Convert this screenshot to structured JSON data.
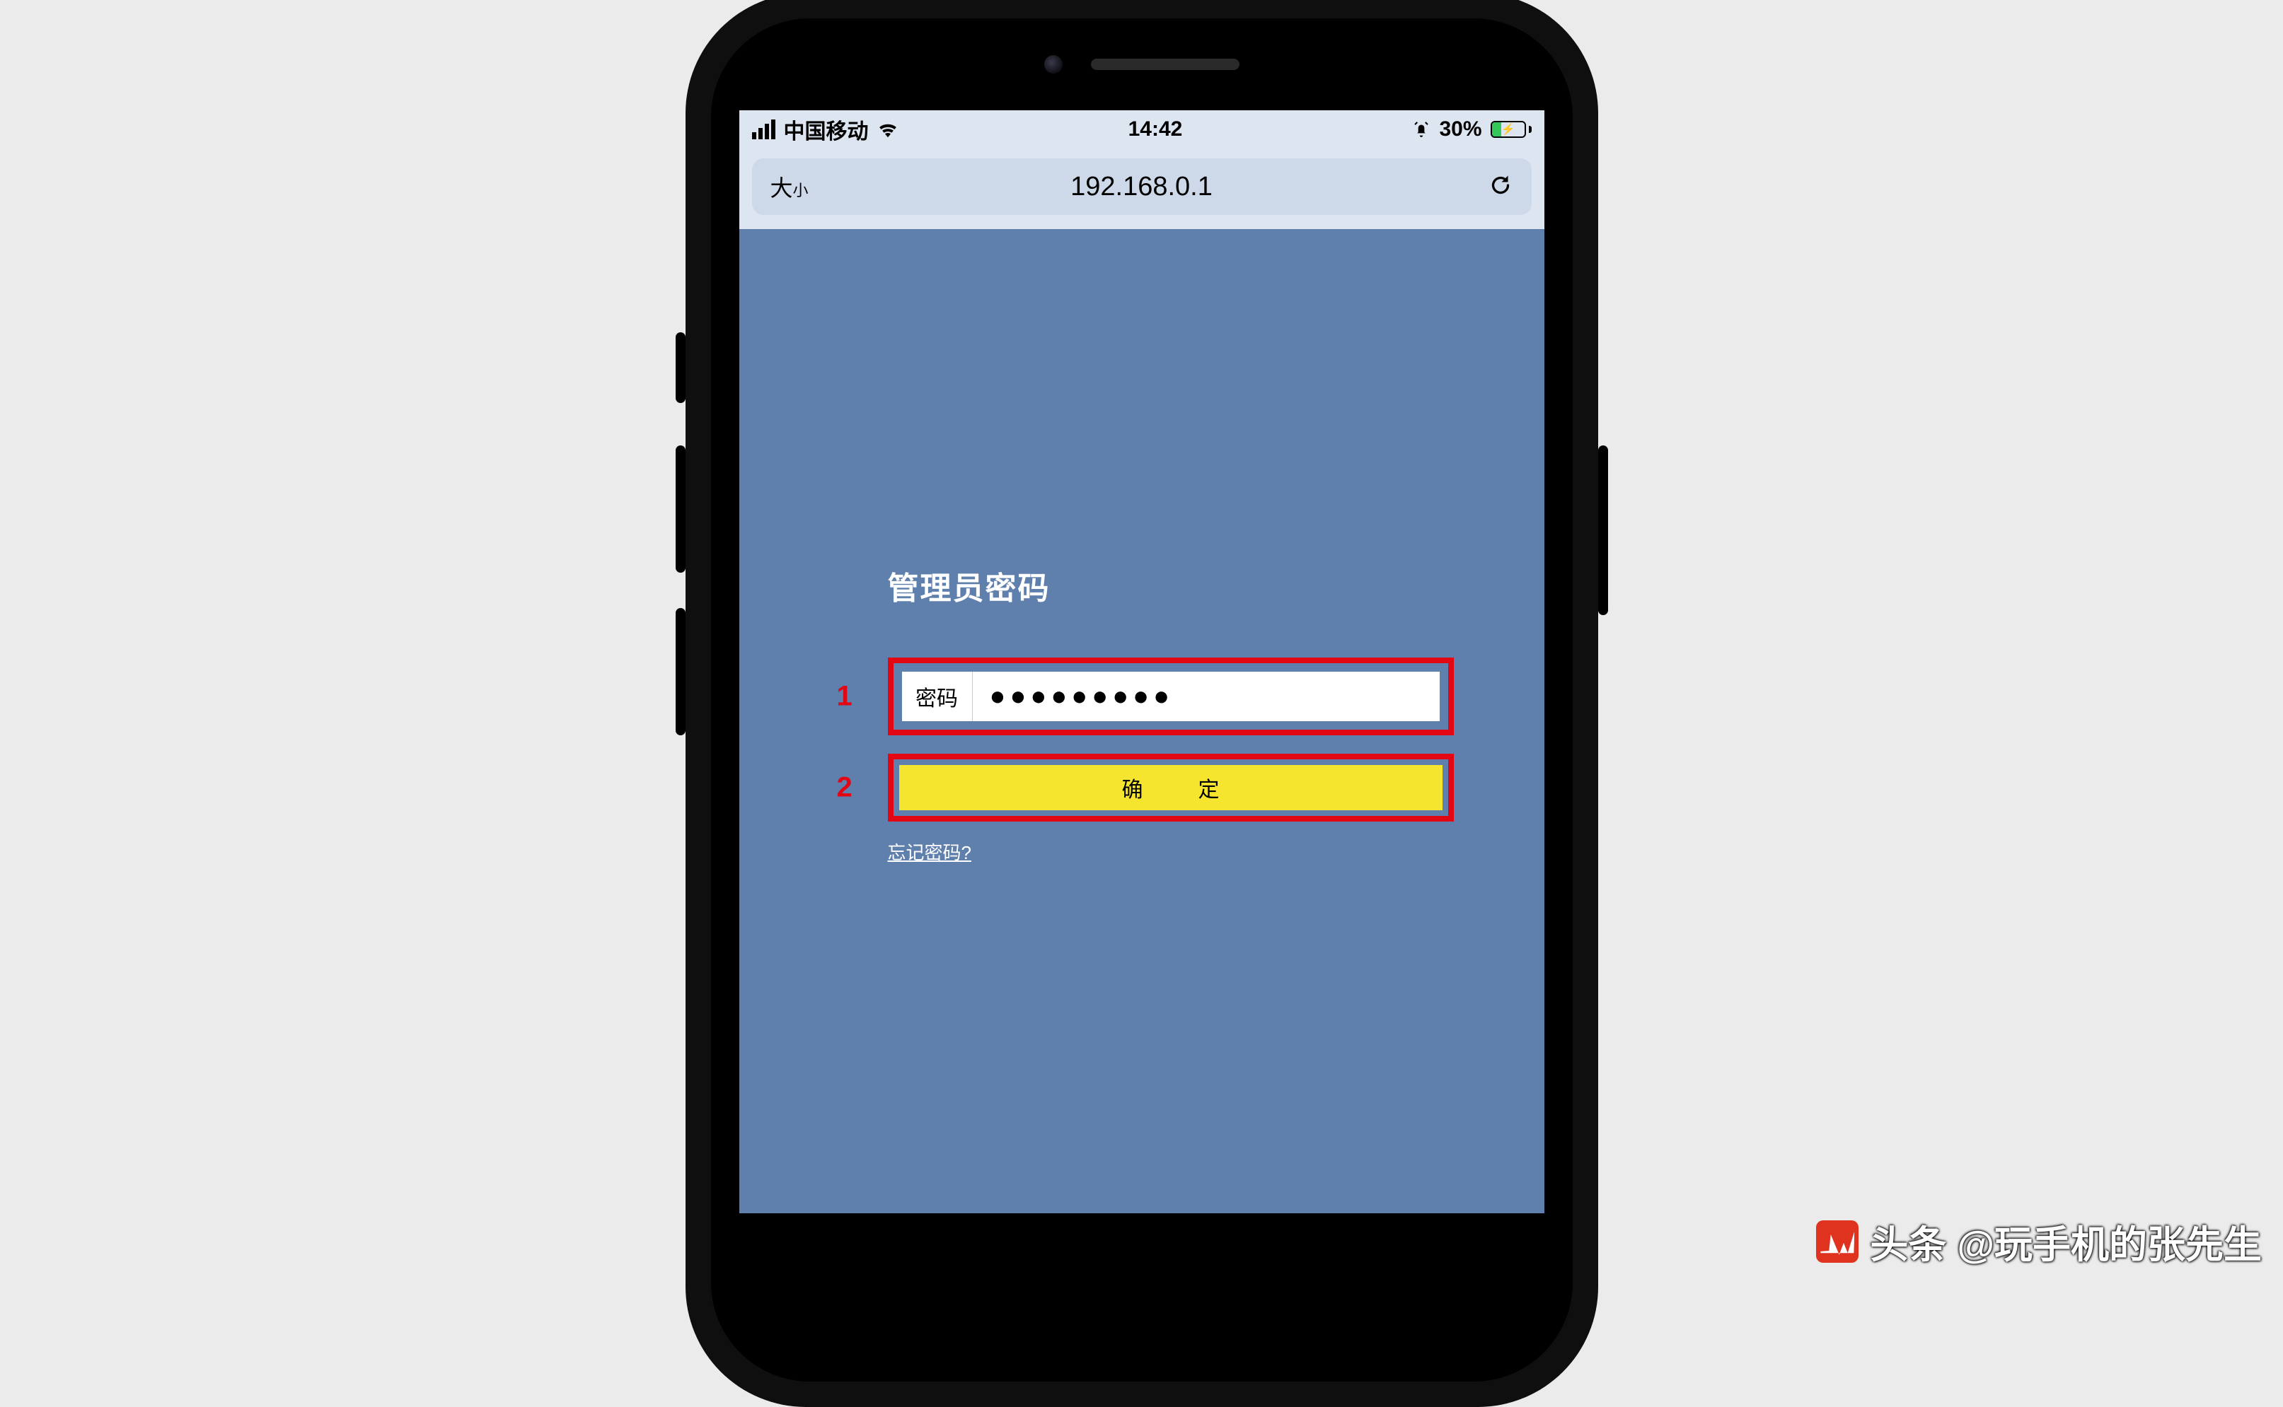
{
  "status": {
    "carrier": "中国移动",
    "time": "14:42",
    "battery_pct": "30%"
  },
  "browser": {
    "aa_large": "大",
    "aa_small": "小",
    "url": "192.168.0.1"
  },
  "login": {
    "title": "管理员密码",
    "password_label": "密码",
    "password_value": "●●●●●●●●●",
    "confirm_label": "确　定",
    "forgot_label": "忘记密码?"
  },
  "annotations": {
    "num1": "1",
    "num2": "2"
  },
  "watermark": {
    "text": "头条 @玩手机的张先生"
  }
}
